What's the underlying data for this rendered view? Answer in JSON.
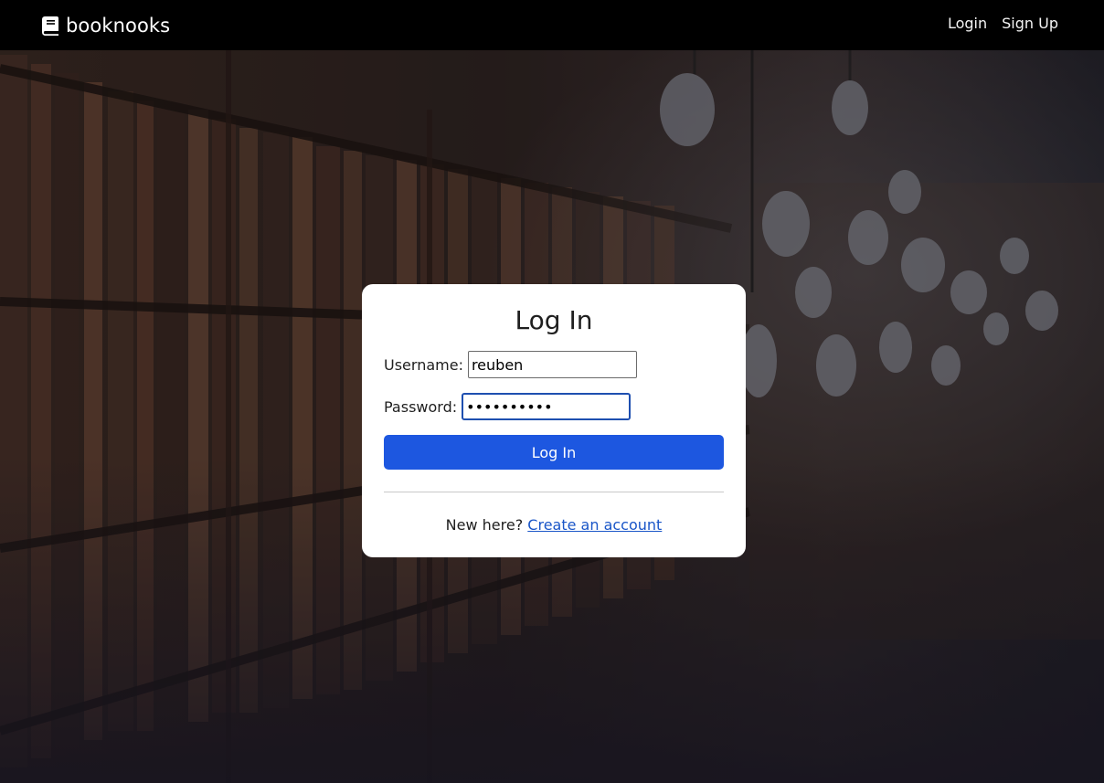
{
  "navbar": {
    "brand_name": "booknooks",
    "brand_icon": "book-icon",
    "links": [
      {
        "label": "Login"
      },
      {
        "label": "Sign Up"
      }
    ]
  },
  "login_card": {
    "title": "Log In",
    "username": {
      "label": "Username:",
      "value": "reuben"
    },
    "password": {
      "label": "Password:",
      "value": "••••••••••"
    },
    "submit_label": "Log In",
    "signup_prompt": "New here?",
    "signup_link_label": "Create an account"
  },
  "colors": {
    "navbar_bg": "#000000",
    "primary_button": "#1d57e0",
    "link": "#1a56c8",
    "focus_border": "#1e4fb0"
  }
}
